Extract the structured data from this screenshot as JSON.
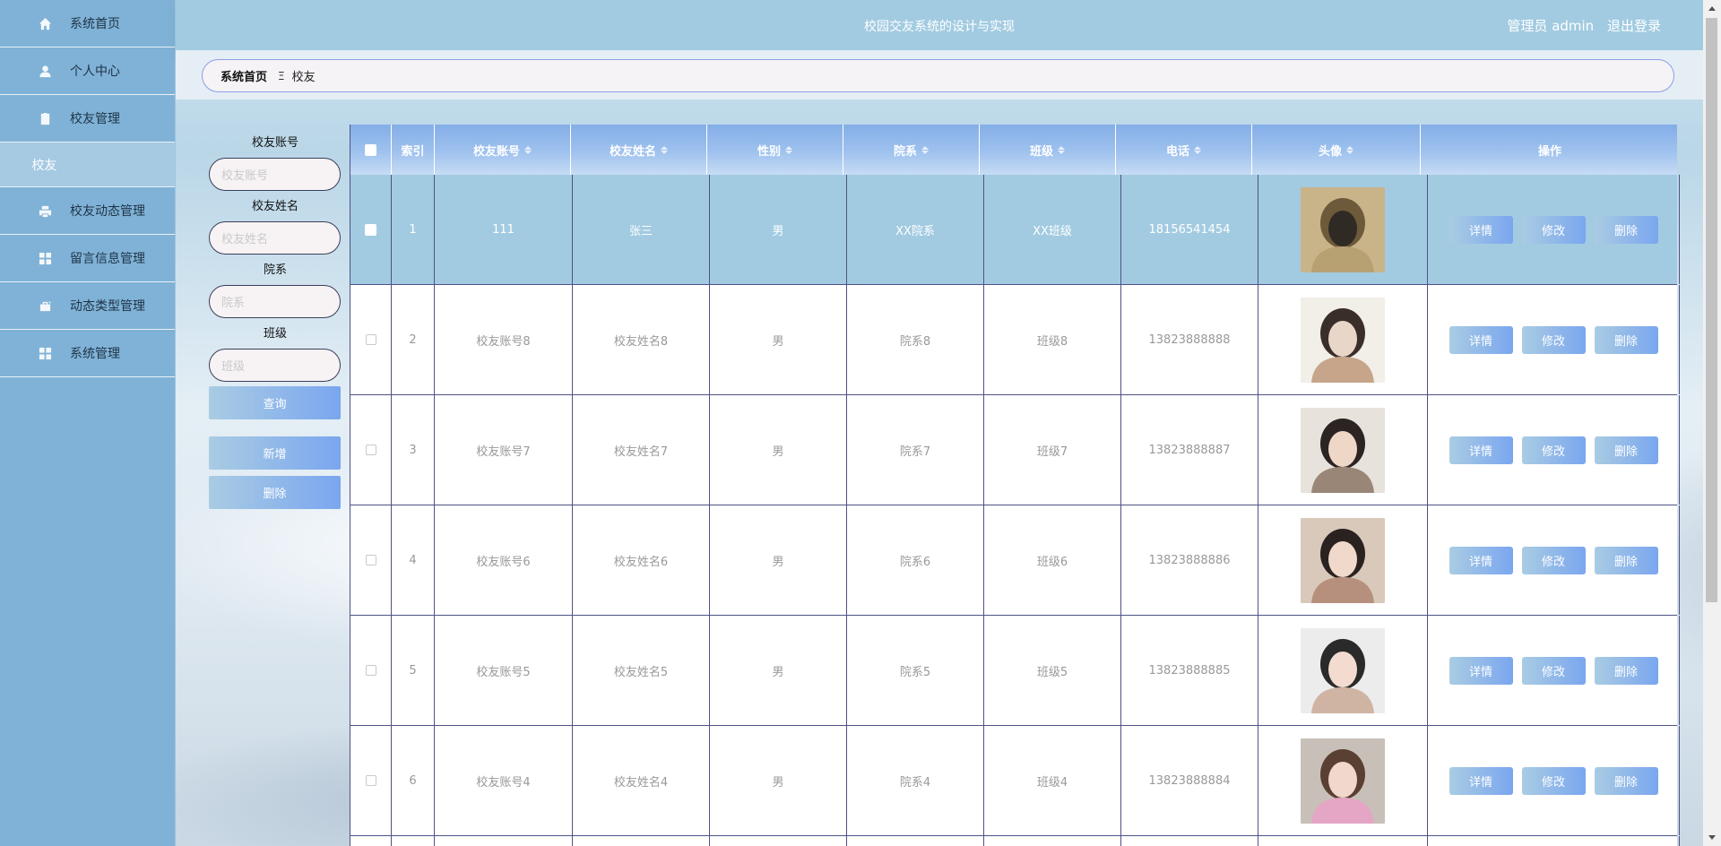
{
  "sidebar": {
    "items": [
      {
        "label": "系统首页",
        "icon": "home-icon"
      },
      {
        "label": "个人中心",
        "icon": "user-icon"
      },
      {
        "label": "校友管理",
        "icon": "clipboard-icon"
      },
      {
        "label": "校友动态管理",
        "icon": "printer-icon"
      },
      {
        "label": "留言信息管理",
        "icon": "grid-icon"
      },
      {
        "label": "动态类型管理",
        "icon": "briefcase-icon"
      },
      {
        "label": "系统管理",
        "icon": "grid-icon"
      }
    ],
    "sub_item": "校友"
  },
  "header": {
    "title": "校园交友系统的设计与实现",
    "user": "管理员 admin",
    "logout": "退出登录"
  },
  "breadcrumb": {
    "home": "系统首页",
    "separator": "Ξ",
    "current": "校友"
  },
  "search": {
    "account_label": "校友账号",
    "account_placeholder": "校友账号",
    "name_label": "校友姓名",
    "name_placeholder": "校友姓名",
    "dept_label": "院系",
    "dept_placeholder": "院系",
    "class_label": "班级",
    "class_placeholder": "班级",
    "query_button": "查询",
    "add_button": "新增",
    "delete_button": "删除"
  },
  "table": {
    "headers": {
      "index": "索引",
      "account": "校友账号",
      "name": "校友姓名",
      "gender": "性别",
      "department": "院系",
      "class": "班级",
      "phone": "电话",
      "avatar": "头像",
      "actions": "操作"
    },
    "rows": [
      {
        "index": "1",
        "account": "111",
        "name": "张三",
        "gender": "男",
        "department": "XX院系",
        "class": "XX班级",
        "phone": "18156541454"
      },
      {
        "index": "2",
        "account": "校友账号8",
        "name": "校友姓名8",
        "gender": "男",
        "department": "院系8",
        "class": "班级8",
        "phone": "13823888888"
      },
      {
        "index": "3",
        "account": "校友账号7",
        "name": "校友姓名7",
        "gender": "男",
        "department": "院系7",
        "class": "班级7",
        "phone": "13823888887"
      },
      {
        "index": "4",
        "account": "校友账号6",
        "name": "校友姓名6",
        "gender": "男",
        "department": "院系6",
        "class": "班级6",
        "phone": "13823888886"
      },
      {
        "index": "5",
        "account": "校友账号5",
        "name": "校友姓名5",
        "gender": "男",
        "department": "院系5",
        "class": "班级5",
        "phone": "13823888885"
      },
      {
        "index": "6",
        "account": "校友账号4",
        "name": "校友姓名4",
        "gender": "男",
        "department": "院系4",
        "class": "班级4",
        "phone": "13823888884"
      }
    ],
    "actions": {
      "detail": "详情",
      "edit": "修改",
      "delete": "删除"
    }
  },
  "colors": {
    "sidebar_bg": "#7fb2d6",
    "header_bg": "#a2cbe1",
    "highlight_row": "#a2cbe1",
    "button_gradient_start": "#a9cce3",
    "button_gradient_end": "#7aa6ef",
    "table_border": "#4e5286"
  }
}
